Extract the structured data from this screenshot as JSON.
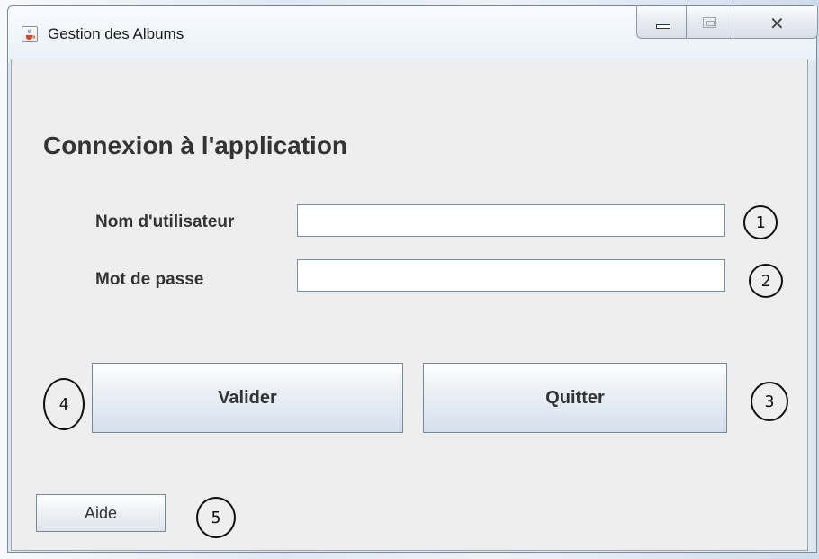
{
  "window": {
    "title": "Gestion des Albums",
    "controls": {
      "minimize": "minimize",
      "maximize": "maximize",
      "close": "✕"
    }
  },
  "form": {
    "heading": "Connexion à l'application",
    "username_label": "Nom d'utilisateur",
    "username_value": "",
    "password_label": "Mot de passe",
    "password_value": ""
  },
  "buttons": {
    "validate": "Valider",
    "quit": "Quitter",
    "help": "Aide"
  },
  "annotations": {
    "one": "1",
    "two": "2",
    "three": "3",
    "four": "4",
    "five": "5"
  },
  "icons": {
    "app": "java-coffee-icon",
    "minimize": "minimize-icon",
    "maximize": "maximize-icon",
    "close": "close-icon"
  }
}
